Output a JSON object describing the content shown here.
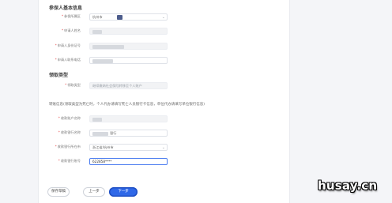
{
  "section_basic": {
    "title": "参保人基本信息",
    "fields": [
      {
        "label": "参保所属区",
        "required": true,
        "value": "杭州市"
      },
      {
        "label": "申请人姓名",
        "required": true,
        "value": ""
      },
      {
        "label": "申请人身份证号",
        "required": true,
        "value": ""
      },
      {
        "label": "申请人联系电话",
        "required": true,
        "value": ""
      }
    ]
  },
  "section_type": {
    "title": "领取类型",
    "field": {
      "label": "领取类型",
      "required": true,
      "value": "继续缴纳社会保险转移至个人账户"
    }
  },
  "section_bank": {
    "note": "转账信息(领取类型为死亡时，个人代办请填写死亡人员银行卡信息，单位代办请填写单位银行信息)",
    "fields": [
      {
        "label": "收款账户名称",
        "required": true,
        "value": ""
      },
      {
        "label": "收款银行名称",
        "required": true,
        "value": "银行"
      },
      {
        "label": "收款银行所在市",
        "required": true,
        "value": "浙江省/杭州市"
      },
      {
        "label": "收款银行账号",
        "required": true,
        "value": "622858****"
      }
    ]
  },
  "footer": {
    "save_label": "保存草稿",
    "prev_label": "上一步",
    "next_label": "下一步"
  },
  "watermark": "husay.cn",
  "colors": {
    "primary": "#2f68e8",
    "required": "#e64a4a",
    "background": "#f4f5f8"
  }
}
